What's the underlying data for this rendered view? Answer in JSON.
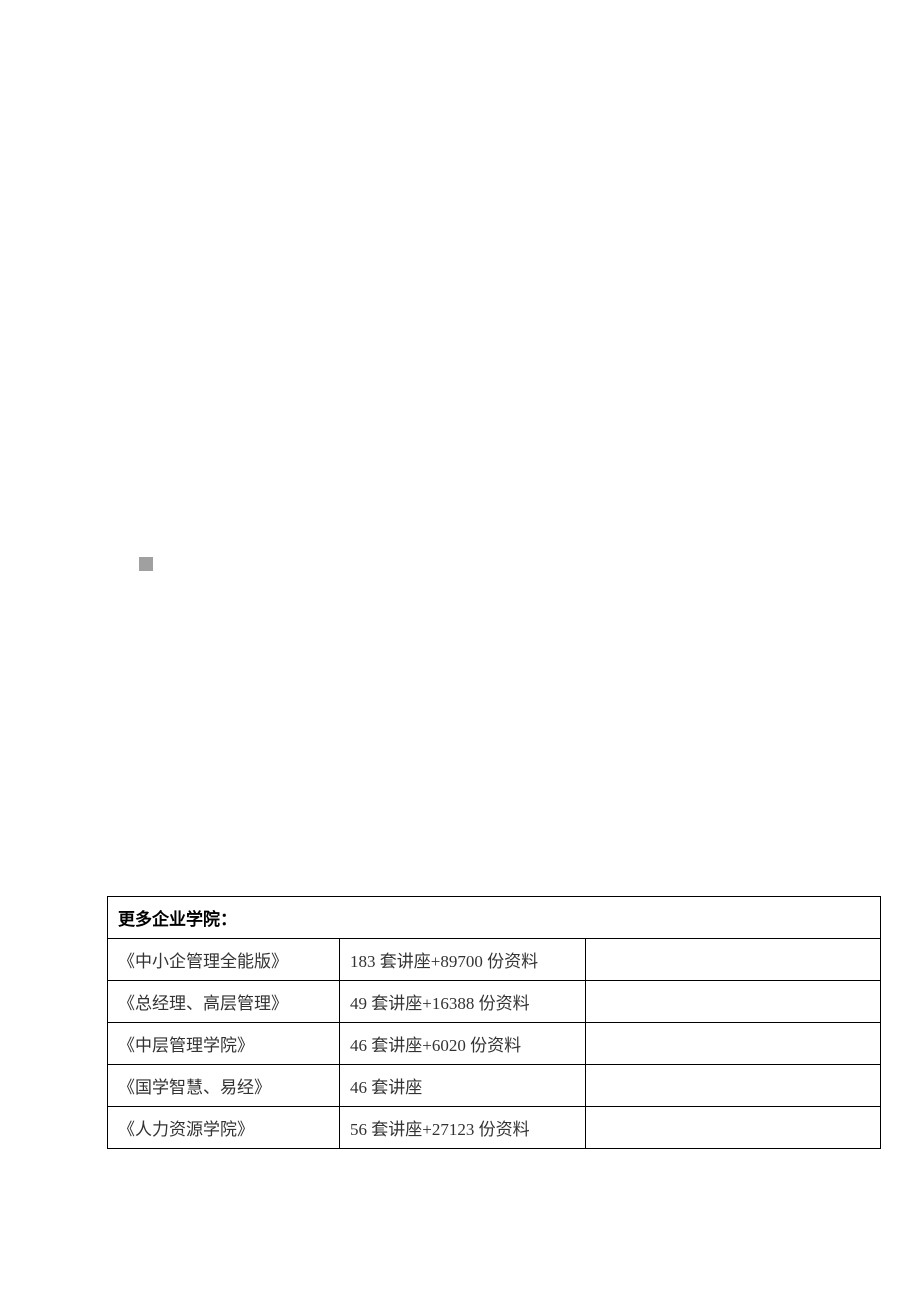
{
  "table": {
    "header": "更多企业学院：",
    "rows": [
      {
        "title": "《中小企管理全能版》",
        "content": "183 套讲座+89700 份资料"
      },
      {
        "title": "《总经理、高层管理》",
        "content": "49 套讲座+16388 份资料"
      },
      {
        "title": "《中层管理学院》",
        "content": "46 套讲座+6020 份资料"
      },
      {
        "title": "《国学智慧、易经》",
        "content": "46 套讲座"
      },
      {
        "title": "《人力资源学院》",
        "content": "56 套讲座+27123 份资料"
      }
    ]
  }
}
